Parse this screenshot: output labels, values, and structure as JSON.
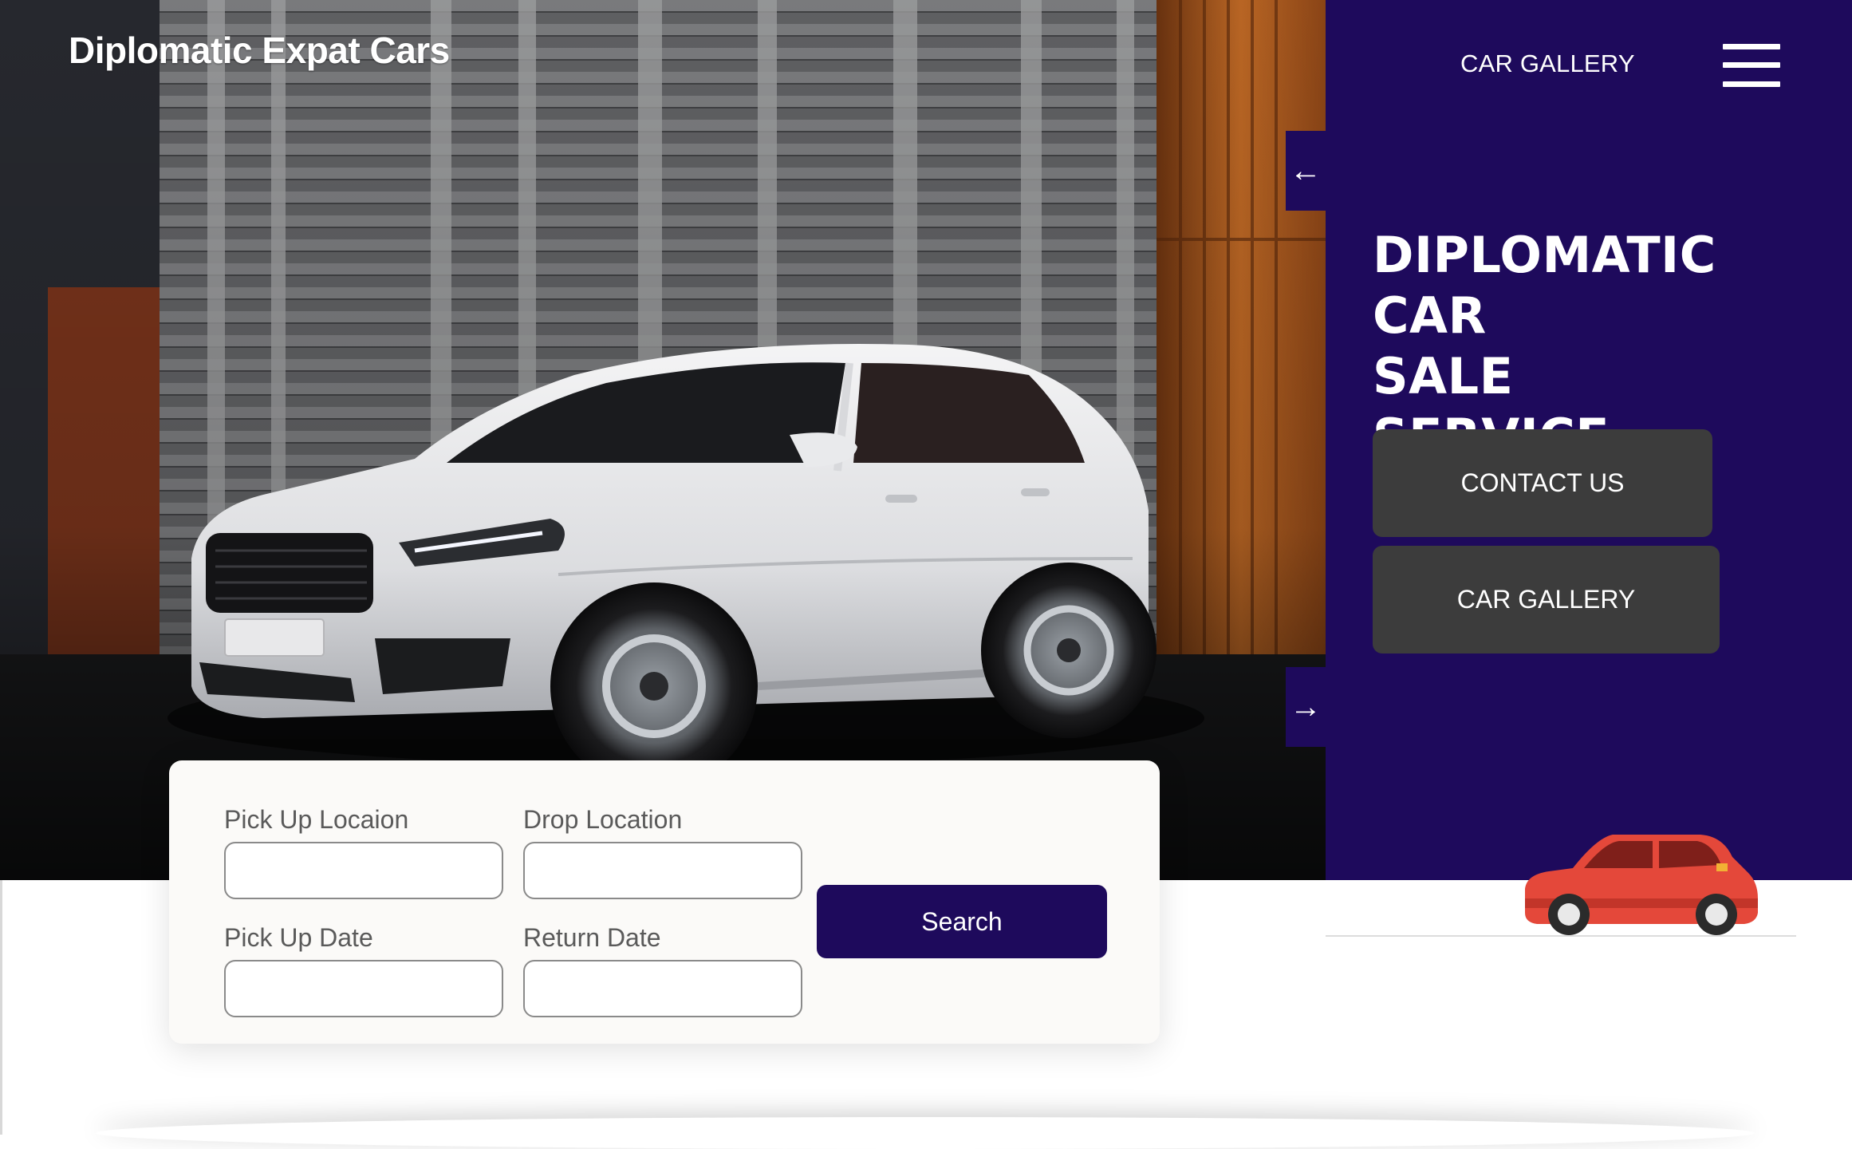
{
  "brand": {
    "name": "Diplomatic Expat Cars"
  },
  "nav": {
    "gallery_link": "CAR GALLERY",
    "menu_icon": "hamburger-menu-icon"
  },
  "slider": {
    "prev_arrow": "←",
    "next_arrow": "→"
  },
  "hero": {
    "headline_lines": [
      "DIPLOMATIC CAR",
      "SALE",
      "SERVICE"
    ],
    "buttons": {
      "contact": "CONTACT US",
      "gallery": "CAR GALLERY"
    }
  },
  "booking": {
    "pickup_location_label": "Pick Up Locaion",
    "drop_location_label": "Drop Location",
    "pickup_date_label": "Pick Up Date",
    "return_date_label": "Return Date",
    "pickup_location_value": "",
    "drop_location_value": "",
    "pickup_date_value": "",
    "return_date_value": "",
    "search_label": "Search"
  },
  "colors": {
    "panel": "#1e0a5c",
    "cta": "#3c3c3c",
    "search_button": "#1e0a5c",
    "mini_car": "#e4483a"
  }
}
